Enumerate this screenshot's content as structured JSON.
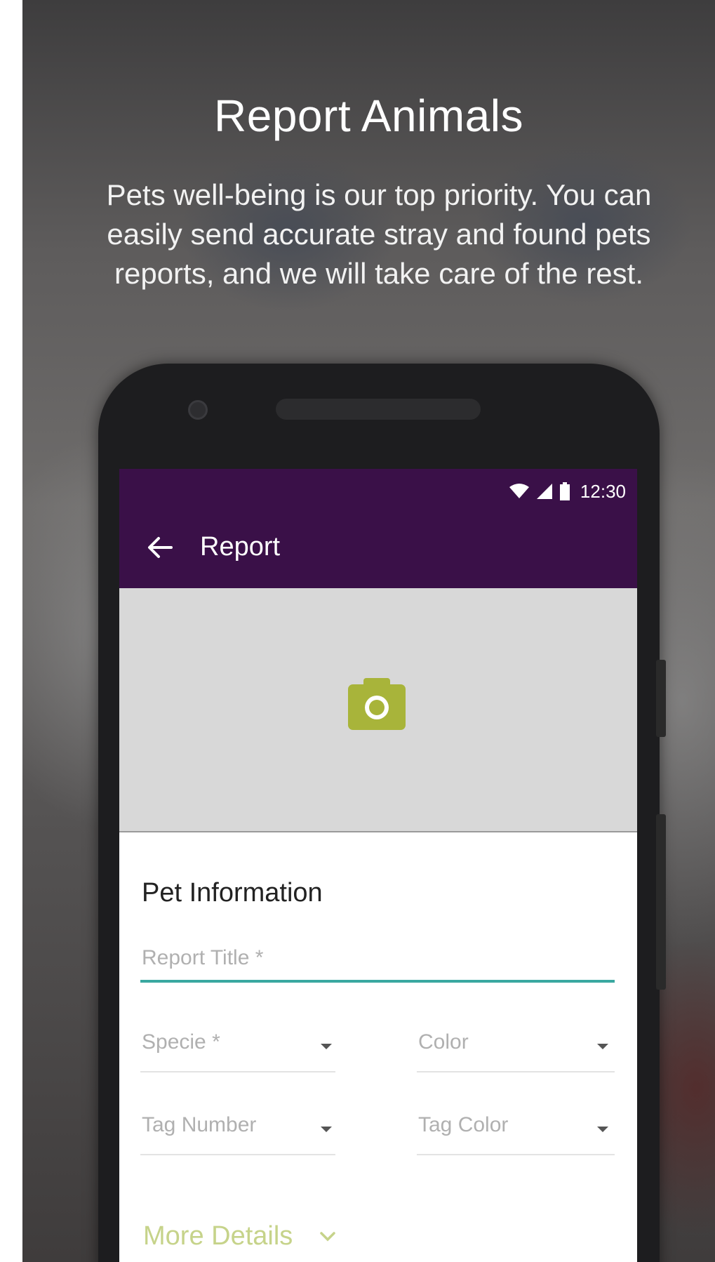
{
  "promo": {
    "headline": "Report Animals",
    "description": "Pets well-being is our top priority. You can easily send accurate stray and found pets reports, and we will take care of the rest."
  },
  "status_bar": {
    "time": "12:30",
    "icons": [
      "wifi-icon",
      "signal-icon",
      "battery-icon"
    ]
  },
  "app_bar": {
    "title": "Report",
    "back_icon": "arrow-left-icon",
    "background": "#3a1048"
  },
  "photo": {
    "icon": "camera-icon",
    "accent": "#a8b43a"
  },
  "form": {
    "section_title": "Pet Information",
    "report_title_placeholder": "Report Title *",
    "specie_placeholder": "Specie *",
    "color_placeholder": "Color",
    "tag_number_placeholder": "Tag Number",
    "tag_color_placeholder": "Tag Color",
    "more_details_label": "More Details",
    "active_underline": "#3aa8a0"
  }
}
